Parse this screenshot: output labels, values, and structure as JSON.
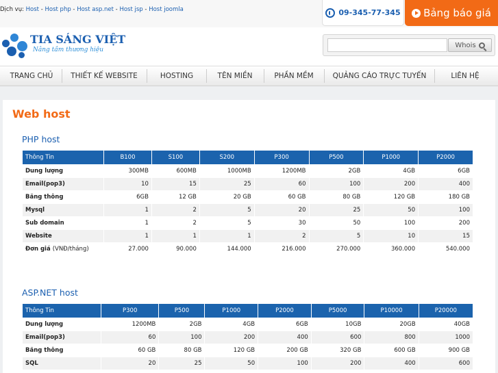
{
  "topbar": {
    "services_label": "Dịch vụ:",
    "services": [
      "Host",
      "Host php",
      "Host asp.net",
      "Host jsp",
      "Host joomla"
    ],
    "phone": "09-345-77-345",
    "price_button": "Bảng báo giá"
  },
  "header": {
    "logo_name": "TIA SÁNG VIỆT",
    "logo_slogan": "Nâng tầm thương hiệu",
    "search_placeholder": "",
    "whois_label": "Whois"
  },
  "nav": [
    "TRANG CHỦ",
    "THIẾT KẾ WEBSITE",
    "HOSTING",
    "TÊN MIỀN",
    "PHẦN MỀM",
    "QUẢNG CÁO TRỰC TUYẾN",
    "LIÊN HỆ"
  ],
  "page_title": "Web host",
  "sections": [
    {
      "title": "PHP host",
      "header": [
        "Thông Tin",
        "B100",
        "S100",
        "S200",
        "P300",
        "P500",
        "P1000",
        "P2000"
      ],
      "rows": [
        [
          "Dung lượng",
          "300MB",
          "600MB",
          "1000MB",
          "1200MB",
          "2GB",
          "4GB",
          "6GB"
        ],
        [
          "Email(pop3)",
          "10",
          "15",
          "25",
          "60",
          "100",
          "200",
          "400"
        ],
        [
          "Băng thông",
          "6GB",
          "12 GB",
          "20 GB",
          "60 GB",
          "80 GB",
          "120 GB",
          "180 GB"
        ],
        [
          "Mysql",
          "1",
          "2",
          "5",
          "20",
          "25",
          "50",
          "100"
        ],
        [
          "Sub domain",
          "1",
          "2",
          "5",
          "30",
          "50",
          "100",
          "200"
        ],
        [
          "Website",
          "1",
          "1",
          "1",
          "2",
          "5",
          "10",
          "15"
        ],
        [
          "Đơn giá",
          "27.000",
          "90.000",
          "144.000",
          "216.000",
          "270.000",
          "360.000",
          "540.000"
        ]
      ],
      "price_unit": "(VNĐ/tháng)"
    },
    {
      "title": "ASP.NET host",
      "header": [
        "Thông Tin",
        "P300",
        "P500",
        "P1000",
        "P2000",
        "P5000",
        "P10000",
        "P20000"
      ],
      "rows": [
        [
          "Dung lượng",
          "1200MB",
          "2GB",
          "4GB",
          "6GB",
          "10GB",
          "20GB",
          "40GB"
        ],
        [
          "Email(pop3)",
          "60",
          "100",
          "200",
          "400",
          "600",
          "800",
          "1000"
        ],
        [
          "Băng thông",
          "60 GB",
          "80 GB",
          "120 GB",
          "200 GB",
          "320 GB",
          "600 GB",
          "900 GB"
        ],
        [
          "SQL",
          "20",
          "25",
          "50",
          "100",
          "200",
          "400",
          "600"
        ]
      ]
    }
  ]
}
